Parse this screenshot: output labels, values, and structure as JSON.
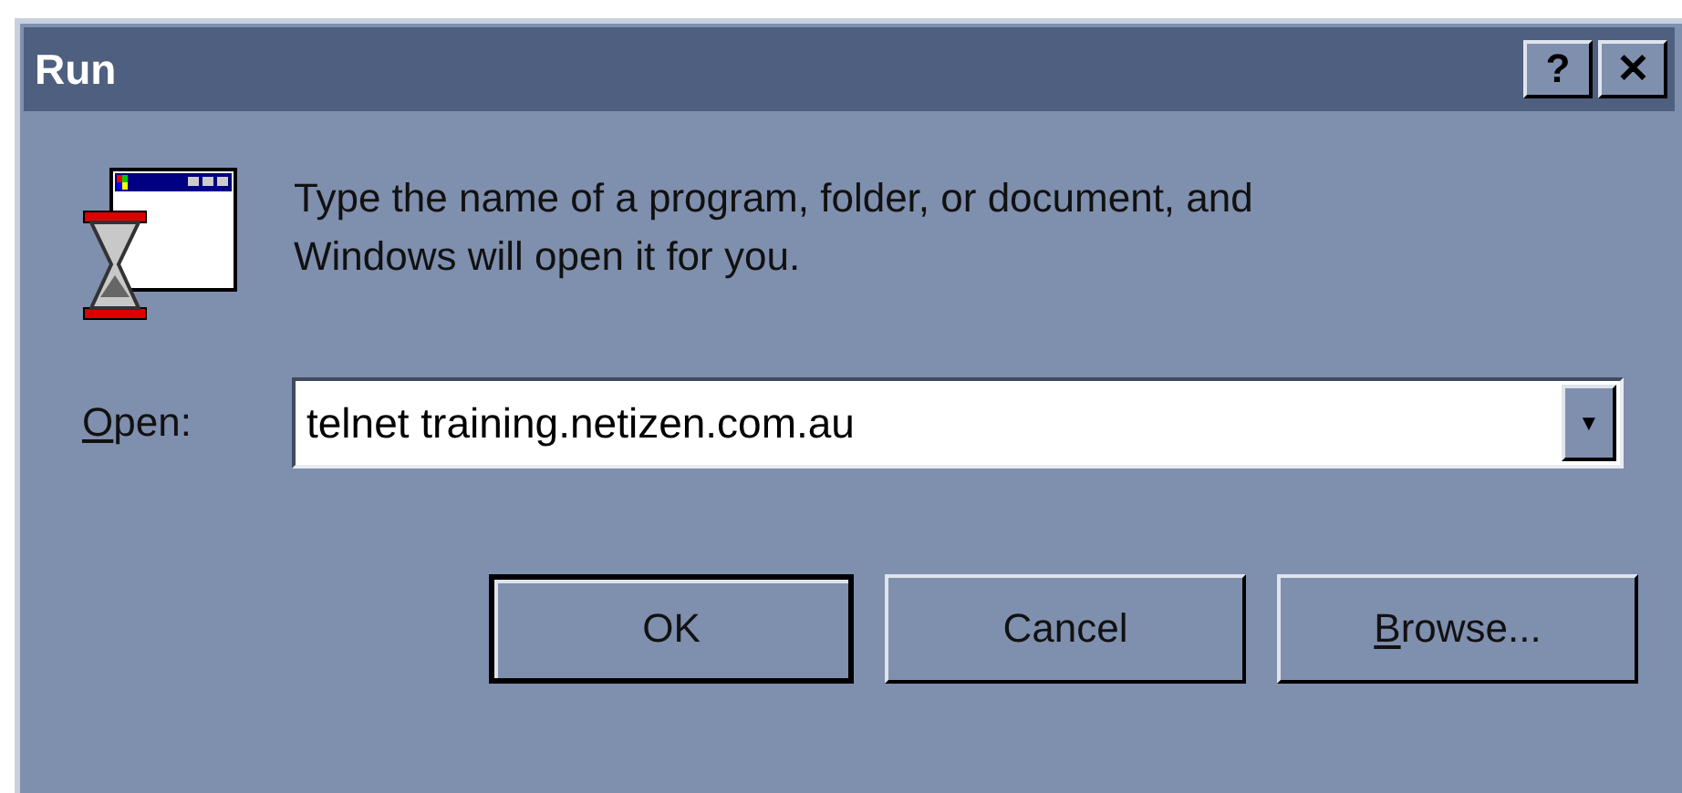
{
  "window": {
    "title": "Run",
    "title_buttons": [
      "?",
      "✕"
    ]
  },
  "message": {
    "lines": [
      "Type the name of a program, folder, or document, and",
      "Windows will open it for you."
    ]
  },
  "open_field": {
    "label_key": "O",
    "label_rest": "pen:",
    "value": "telnet training.netizen.com.au",
    "dropdown": "▼"
  },
  "buttons": [
    {
      "rest": "OK",
      "default": true
    },
    {
      "rest": "Cancel",
      "default": false
    },
    {
      "key": "B",
      "rest": "rowse...",
      "default": false
    }
  ]
}
